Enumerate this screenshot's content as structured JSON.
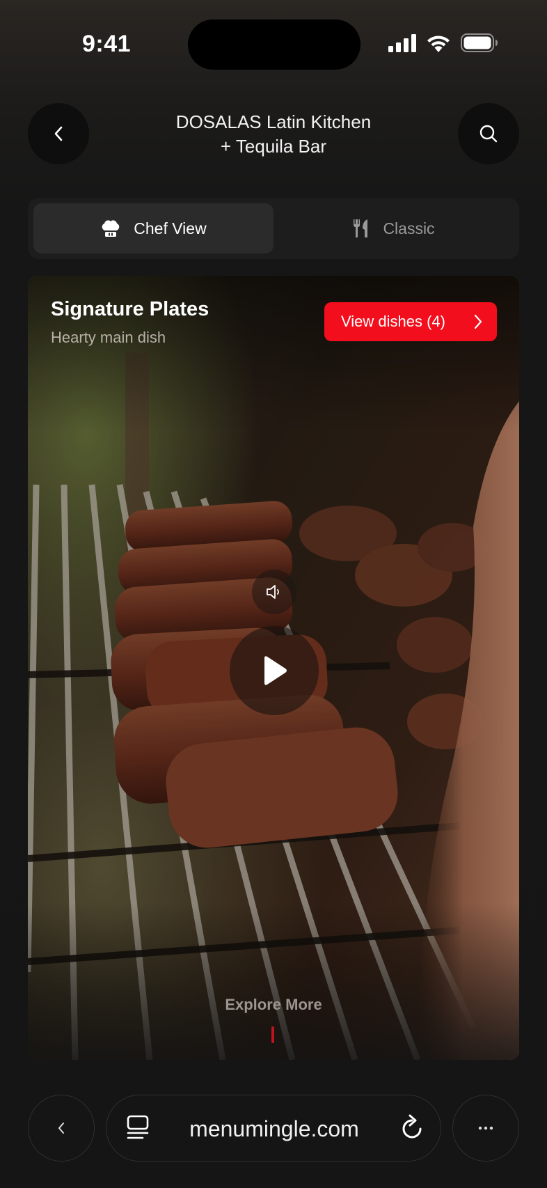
{
  "status_bar": {
    "time": "9:41"
  },
  "header": {
    "title_line1": "DOSALAS Latin Kitchen",
    "title_line2": "+ Tequila Bar",
    "back_icon": "chevron-left-icon",
    "search_icon": "search-icon"
  },
  "view_toggle": {
    "selected": "Chef View",
    "options": [
      {
        "label": "Chef View",
        "icon": "chef-hat-icon",
        "active": true
      },
      {
        "label": "Classic",
        "icon": "fork-knife-icon",
        "active": false
      }
    ]
  },
  "feature_card": {
    "title": "Signature Plates",
    "subtitle": "Hearty main dish",
    "cta_label": "View dishes (4)",
    "explore_label": "Explore More",
    "media": "grilled-meat-skewers-video"
  },
  "browser_bar": {
    "url": "menumingle.com"
  },
  "colors": {
    "background": "#151515",
    "accent_red": "#f20e1c",
    "muted_text": "#9a9a9a"
  }
}
